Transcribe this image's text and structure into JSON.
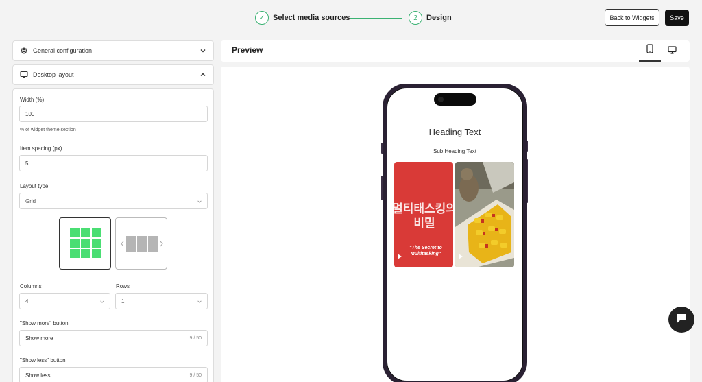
{
  "steps": [
    {
      "label": "Select media sources",
      "state": "done",
      "marker": "✓"
    },
    {
      "label": "Design",
      "state": "active",
      "marker": "2"
    }
  ],
  "header": {
    "back_label": "Back to Widgets",
    "save_label": "Save"
  },
  "panel": {
    "general_label": "General configuration",
    "desktop_label": "Desktop layout",
    "width": {
      "label": "Width (%)",
      "value": "100",
      "hint": "% of widget theme section"
    },
    "spacing": {
      "label": "Item spacing (px)",
      "value": "5"
    },
    "layout_type": {
      "label": "Layout type",
      "value": "Grid"
    },
    "columns": {
      "label": "Columns",
      "value": "4"
    },
    "rows": {
      "label": "Rows",
      "value": "1"
    },
    "show_more": {
      "label": "\"Show more\" button",
      "value": "Show more",
      "counter": "9 / 50"
    },
    "show_less": {
      "label": "\"Show less\" button",
      "value": "Show less",
      "counter": "9 / 50"
    }
  },
  "preview": {
    "title": "Preview",
    "heading": "Heading Text",
    "subheading": "Sub Heading Text",
    "tile1_korean": "멀티태스킹의 비밀",
    "tile1_caption": "\"The Secret to Multitasking\""
  },
  "colors": {
    "accent": "#3bb273",
    "grid_green": "#4ade73",
    "tile_red": "#d93a37",
    "phone_frame": "#2a2133"
  },
  "icons": {
    "general": "gear-icon",
    "desktop": "monitor-icon",
    "mobile_device": "phone-icon",
    "desktop_device": "desktop-icon",
    "chat": "chat-icon"
  }
}
